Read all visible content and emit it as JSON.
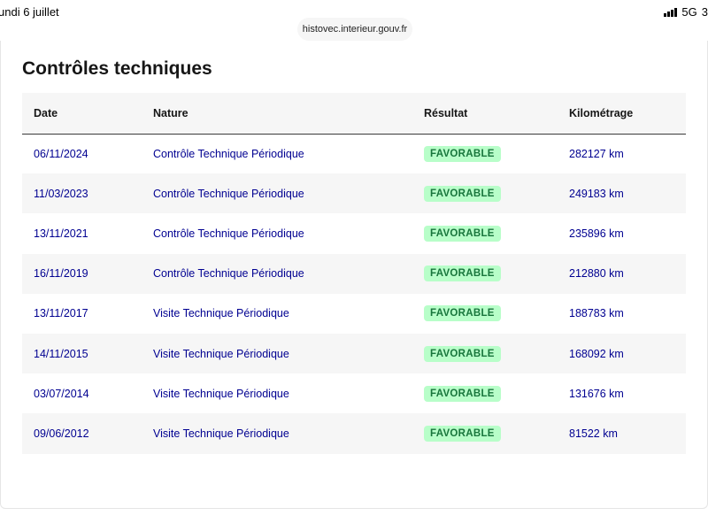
{
  "status_bar": {
    "date": "undi 6 juillet",
    "network": "5G",
    "battery": "3"
  },
  "browser": {
    "url": "histovec.interieur.gouv.fr"
  },
  "section": {
    "title": "Contrôles techniques"
  },
  "table": {
    "headers": [
      "Date",
      "Nature",
      "Résultat",
      "Kilométrage"
    ],
    "rows": [
      {
        "date": "06/11/2024",
        "nature": "Contrôle Technique Périodique",
        "result": "FAVORABLE",
        "mileage": "282127 km"
      },
      {
        "date": "11/03/2023",
        "nature": "Contrôle Technique Périodique",
        "result": "FAVORABLE",
        "mileage": "249183 km"
      },
      {
        "date": "13/11/2021",
        "nature": "Contrôle Technique Périodique",
        "result": "FAVORABLE",
        "mileage": "235896 km"
      },
      {
        "date": "16/11/2019",
        "nature": "Contrôle Technique Périodique",
        "result": "FAVORABLE",
        "mileage": "212880 km"
      },
      {
        "date": "13/11/2017",
        "nature": "Visite Technique Périodique",
        "result": "FAVORABLE",
        "mileage": "188783 km"
      },
      {
        "date": "14/11/2015",
        "nature": "Visite Technique Périodique",
        "result": "FAVORABLE",
        "mileage": "168092 km"
      },
      {
        "date": "03/07/2014",
        "nature": "Visite Technique Périodique",
        "result": "FAVORABLE",
        "mileage": "131676 km"
      },
      {
        "date": "09/06/2012",
        "nature": "Visite Technique Périodique",
        "result": "FAVORABLE",
        "mileage": "81522 km"
      }
    ]
  },
  "colors": {
    "link": "#000091",
    "badge_bg": "#b8fec9",
    "badge_text": "#18753c",
    "stripe": "#f6f6f6"
  }
}
